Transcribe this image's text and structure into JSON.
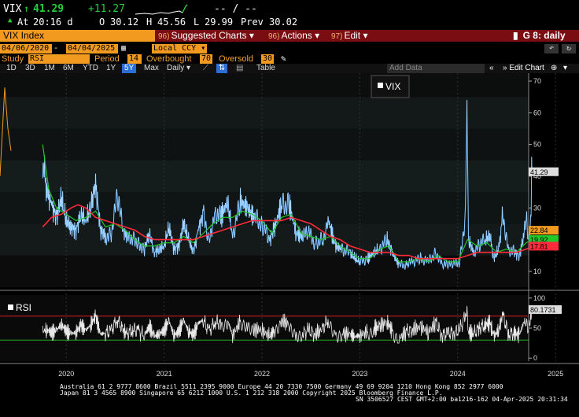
{
  "quote": {
    "ticker": "VIX",
    "last": "41.29",
    "change": "+11.27",
    "bid_ask": "-- / --"
  },
  "info": {
    "time_label": "At",
    "time": "20:16 d",
    "open_label": "O",
    "open": "30.12",
    "high_label": "H",
    "high": "45.56",
    "low_label": "L",
    "low": "29.99",
    "prev_label": "Prev",
    "prev": "30.02"
  },
  "menubar": {
    "security": "VIX Index",
    "items": [
      {
        "num": "96)",
        "label": "Suggested Charts ▾"
      },
      {
        "num": "96)",
        "label": "Actions ▾"
      },
      {
        "num": "97)",
        "label": "Edit ▾"
      }
    ],
    "page": "G 8: daily"
  },
  "daterow": {
    "start": "04/06/2020",
    "end": "04/04/2025",
    "currency": "Local CCY"
  },
  "studyrow": {
    "study_label": "Study",
    "study": "RSI",
    "period_label": "Period",
    "period": "14",
    "overbought_label": "Overbought",
    "overbought": "70",
    "oversold_label": "Oversold",
    "oversold": "30"
  },
  "toolbar": {
    "ranges": [
      "1D",
      "3D",
      "1M",
      "6M",
      "YTD",
      "1Y",
      "5Y",
      "Max"
    ],
    "active_range": "5Y",
    "frequency": "Daily ▾",
    "table": "Table",
    "add_data_placeholder": "Add Data",
    "edit_chart": "Edit Chart"
  },
  "chart_data": [
    {
      "type": "line",
      "legend": [
        {
          "name": "VIX",
          "color": "#ffffff"
        }
      ],
      "x_ticks": [
        "2020",
        "2021",
        "2022",
        "2023",
        "2024",
        "2025"
      ],
      "y_ticks": [
        10,
        20,
        30,
        40,
        50,
        60,
        70
      ],
      "ylim": [
        5,
        72
      ],
      "series_colors": {
        "price": "#4aa8ff",
        "ma_fast": "#22c82a",
        "ma_slow": "#ff2a3a"
      },
      "last_value_tags": [
        {
          "value": "41.29",
          "y": 41.29,
          "bg": "#dddddd",
          "fg": "#000000"
        },
        {
          "value": "22.84",
          "y": 22.84,
          "bg": "#f29a1f",
          "fg": "#000000"
        },
        {
          "value": "19.92",
          "y": 19.92,
          "bg": "#22c82a",
          "fg": "#000000"
        },
        {
          "value": "17.81",
          "y": 17.81,
          "bg": "#ff2a3a",
          "fg": "#000000"
        }
      ],
      "price_points": [
        [
          2020.26,
          45
        ],
        [
          2020.3,
          36
        ],
        [
          2020.35,
          31
        ],
        [
          2020.4,
          27
        ],
        [
          2020.45,
          33
        ],
        [
          2020.5,
          26
        ],
        [
          2020.55,
          24
        ],
        [
          2020.6,
          23
        ],
        [
          2020.65,
          28
        ],
        [
          2020.7,
          26
        ],
        [
          2020.75,
          30
        ],
        [
          2020.8,
          38
        ],
        [
          2020.85,
          23
        ],
        [
          2020.9,
          21
        ],
        [
          2020.96,
          22
        ],
        [
          2021.02,
          33
        ],
        [
          2021.08,
          24
        ],
        [
          2021.12,
          20
        ],
        [
          2021.18,
          21
        ],
        [
          2021.24,
          19
        ],
        [
          2021.3,
          17
        ],
        [
          2021.35,
          22
        ],
        [
          2021.4,
          16
        ],
        [
          2021.45,
          17
        ],
        [
          2021.5,
          18
        ],
        [
          2021.55,
          24
        ],
        [
          2021.6,
          17
        ],
        [
          2021.65,
          18
        ],
        [
          2021.7,
          25
        ],
        [
          2021.75,
          20
        ],
        [
          2021.8,
          16
        ],
        [
          2021.85,
          23
        ],
        [
          2021.9,
          28
        ],
        [
          2021.96,
          20
        ],
        [
          2022.02,
          29
        ],
        [
          2022.08,
          27
        ],
        [
          2022.15,
          32
        ],
        [
          2022.2,
          21
        ],
        [
          2022.28,
          32
        ],
        [
          2022.35,
          30
        ],
        [
          2022.42,
          27
        ],
        [
          2022.5,
          25
        ],
        [
          2022.58,
          20
        ],
        [
          2022.63,
          24
        ],
        [
          2022.7,
          31
        ],
        [
          2022.78,
          31
        ],
        [
          2022.85,
          22
        ],
        [
          2022.92,
          21
        ],
        [
          2022.98,
          22
        ],
        [
          2023.04,
          19
        ],
        [
          2023.12,
          20
        ],
        [
          2023.18,
          26
        ],
        [
          2023.25,
          18
        ],
        [
          2023.32,
          17
        ],
        [
          2023.4,
          16
        ],
        [
          2023.45,
          14
        ],
        [
          2023.5,
          13
        ],
        [
          2023.58,
          14
        ],
        [
          2023.65,
          16
        ],
        [
          2023.7,
          17
        ],
        [
          2023.78,
          20
        ],
        [
          2023.83,
          16
        ],
        [
          2023.9,
          12
        ],
        [
          2023.98,
          12
        ],
        [
          2024.04,
          13
        ],
        [
          2024.12,
          14
        ],
        [
          2024.2,
          13
        ],
        [
          2024.28,
          16
        ],
        [
          2024.34,
          12
        ],
        [
          2024.4,
          12
        ],
        [
          2024.46,
          12
        ],
        [
          2024.52,
          13
        ],
        [
          2024.58,
          28
        ],
        [
          2024.595,
          65
        ],
        [
          2024.61,
          20
        ],
        [
          2024.66,
          16
        ],
        [
          2024.72,
          18
        ],
        [
          2024.78,
          20
        ],
        [
          2024.83,
          21
        ],
        [
          2024.87,
          14
        ],
        [
          2024.92,
          17
        ],
        [
          2024.96,
          28
        ],
        [
          2025.02,
          17
        ],
        [
          2025.08,
          16
        ],
        [
          2025.13,
          15
        ],
        [
          2025.18,
          22
        ],
        [
          2025.2,
          27
        ],
        [
          2025.22,
          21
        ],
        [
          2025.24,
          22
        ],
        [
          2025.25,
          30
        ],
        [
          2025.256,
          45.56
        ],
        [
          2025.26,
          41.29
        ]
      ],
      "ma_fast_points": [
        [
          2020.26,
          50
        ],
        [
          2020.32,
          36
        ],
        [
          2020.4,
          30
        ],
        [
          2020.5,
          28
        ],
        [
          2020.6,
          26
        ],
        [
          2020.7,
          27
        ],
        [
          2020.8,
          29
        ],
        [
          2020.9,
          24
        ],
        [
          2021.0,
          25
        ],
        [
          2021.1,
          23
        ],
        [
          2021.2,
          20
        ],
        [
          2021.3,
          18
        ],
        [
          2021.4,
          18
        ],
        [
          2021.5,
          19
        ],
        [
          2021.6,
          19
        ],
        [
          2021.7,
          21
        ],
        [
          2021.8,
          19
        ],
        [
          2021.9,
          22
        ],
        [
          2022.0,
          25
        ],
        [
          2022.1,
          27
        ],
        [
          2022.2,
          27
        ],
        [
          2022.3,
          29
        ],
        [
          2022.4,
          28
        ],
        [
          2022.5,
          26
        ],
        [
          2022.6,
          22
        ],
        [
          2022.7,
          27
        ],
        [
          2022.8,
          28
        ],
        [
          2022.9,
          22
        ],
        [
          2023.0,
          21
        ],
        [
          2023.1,
          20
        ],
        [
          2023.2,
          21
        ],
        [
          2023.3,
          18
        ],
        [
          2023.4,
          16
        ],
        [
          2023.5,
          14
        ],
        [
          2023.6,
          14
        ],
        [
          2023.7,
          17
        ],
        [
          2023.8,
          18
        ],
        [
          2023.9,
          13
        ],
        [
          2024.0,
          13
        ],
        [
          2024.1,
          14
        ],
        [
          2024.2,
          13
        ],
        [
          2024.3,
          15
        ],
        [
          2024.4,
          13
        ],
        [
          2024.5,
          13
        ],
        [
          2024.6,
          20
        ],
        [
          2024.7,
          18
        ],
        [
          2024.8,
          19
        ],
        [
          2024.9,
          16
        ],
        [
          2025.0,
          17
        ],
        [
          2025.1,
          16
        ],
        [
          2025.2,
          19
        ],
        [
          2025.26,
          19.92
        ]
      ],
      "ma_slow_points": [
        [
          2020.26,
          24
        ],
        [
          2020.35,
          27
        ],
        [
          2020.45,
          28
        ],
        [
          2020.55,
          30
        ],
        [
          2020.62,
          31
        ],
        [
          2020.7,
          30
        ],
        [
          2020.8,
          27
        ],
        [
          2020.9,
          26
        ],
        [
          2021.0,
          25
        ],
        [
          2021.1,
          24
        ],
        [
          2021.2,
          23
        ],
        [
          2021.3,
          21
        ],
        [
          2021.4,
          20
        ],
        [
          2021.5,
          20
        ],
        [
          2021.6,
          20
        ],
        [
          2021.7,
          20
        ],
        [
          2021.8,
          20
        ],
        [
          2021.9,
          21
        ],
        [
          2022.0,
          22
        ],
        [
          2022.1,
          23
        ],
        [
          2022.2,
          24
        ],
        [
          2022.3,
          25
        ],
        [
          2022.4,
          26
        ],
        [
          2022.5,
          26
        ],
        [
          2022.6,
          26
        ],
        [
          2022.7,
          26
        ],
        [
          2022.8,
          27
        ],
        [
          2022.9,
          26
        ],
        [
          2023.0,
          25
        ],
        [
          2023.1,
          23
        ],
        [
          2023.2,
          21
        ],
        [
          2023.3,
          20
        ],
        [
          2023.4,
          18
        ],
        [
          2023.5,
          17
        ],
        [
          2023.6,
          16
        ],
        [
          2023.7,
          16
        ],
        [
          2023.8,
          16
        ],
        [
          2023.9,
          15
        ],
        [
          2024.0,
          15
        ],
        [
          2024.1,
          14
        ],
        [
          2024.2,
          14
        ],
        [
          2024.3,
          14
        ],
        [
          2024.4,
          14
        ],
        [
          2024.5,
          14
        ],
        [
          2024.6,
          15
        ],
        [
          2024.7,
          16
        ],
        [
          2024.8,
          16
        ],
        [
          2024.9,
          16
        ],
        [
          2025.0,
          16
        ],
        [
          2025.1,
          16
        ],
        [
          2025.2,
          17
        ],
        [
          2025.26,
          17.81
        ]
      ]
    },
    {
      "type": "line",
      "legend": [
        {
          "name": "RSI",
          "color": "#ffffff"
        }
      ],
      "y_ticks": [
        0,
        50,
        100
      ],
      "ylim": [
        -5,
        105
      ],
      "overbought": 70,
      "oversold": 30,
      "last_value_tag": {
        "value": "80.1731",
        "y": 80.17
      },
      "rsi_points": [
        [
          2020.26,
          44
        ],
        [
          2020.3,
          48
        ],
        [
          2020.35,
          42
        ],
        [
          2020.4,
          46
        ],
        [
          2020.45,
          57
        ],
        [
          2020.5,
          44
        ],
        [
          2020.55,
          41
        ],
        [
          2020.6,
          43
        ],
        [
          2020.65,
          55
        ],
        [
          2020.7,
          46
        ],
        [
          2020.75,
          56
        ],
        [
          2020.8,
          70
        ],
        [
          2020.85,
          40
        ],
        [
          2020.9,
          42
        ],
        [
          2020.96,
          45
        ],
        [
          2021.02,
          66
        ],
        [
          2021.08,
          46
        ],
        [
          2021.12,
          40
        ],
        [
          2021.18,
          48
        ],
        [
          2021.24,
          44
        ],
        [
          2021.3,
          39
        ],
        [
          2021.35,
          53
        ],
        [
          2021.4,
          36
        ],
        [
          2021.45,
          41
        ],
        [
          2021.5,
          46
        ],
        [
          2021.55,
          62
        ],
        [
          2021.6,
          38
        ],
        [
          2021.65,
          44
        ],
        [
          2021.7,
          63
        ],
        [
          2021.75,
          45
        ],
        [
          2021.8,
          38
        ],
        [
          2021.85,
          58
        ],
        [
          2021.9,
          64
        ],
        [
          2021.96,
          43
        ],
        [
          2022.02,
          62
        ],
        [
          2022.08,
          55
        ],
        [
          2022.15,
          63
        ],
        [
          2022.2,
          38
        ],
        [
          2022.28,
          61
        ],
        [
          2022.35,
          57
        ],
        [
          2022.42,
          48
        ],
        [
          2022.5,
          47
        ],
        [
          2022.58,
          36
        ],
        [
          2022.63,
          48
        ],
        [
          2022.7,
          62
        ],
        [
          2022.78,
          57
        ],
        [
          2022.85,
          40
        ],
        [
          2022.92,
          42
        ],
        [
          2022.98,
          46
        ],
        [
          2023.04,
          40
        ],
        [
          2023.12,
          48
        ],
        [
          2023.18,
          66
        ],
        [
          2023.25,
          39
        ],
        [
          2023.32,
          42
        ],
        [
          2023.4,
          40
        ],
        [
          2023.45,
          36
        ],
        [
          2023.5,
          38
        ],
        [
          2023.58,
          43
        ],
        [
          2023.65,
          50
        ],
        [
          2023.7,
          52
        ],
        [
          2023.78,
          61
        ],
        [
          2023.83,
          44
        ],
        [
          2023.9,
          33
        ],
        [
          2023.98,
          43
        ],
        [
          2024.04,
          48
        ],
        [
          2024.12,
          52
        ],
        [
          2024.2,
          44
        ],
        [
          2024.28,
          58
        ],
        [
          2024.34,
          38
        ],
        [
          2024.4,
          41
        ],
        [
          2024.46,
          43
        ],
        [
          2024.52,
          46
        ],
        [
          2024.58,
          72
        ],
        [
          2024.595,
          85
        ],
        [
          2024.61,
          44
        ],
        [
          2024.66,
          40
        ],
        [
          2024.72,
          50
        ],
        [
          2024.78,
          56
        ],
        [
          2024.83,
          58
        ],
        [
          2024.87,
          36
        ],
        [
          2024.92,
          48
        ],
        [
          2024.96,
          72
        ],
        [
          2025.02,
          40
        ],
        [
          2025.08,
          42
        ],
        [
          2025.13,
          38
        ],
        [
          2025.18,
          62
        ],
        [
          2025.2,
          68
        ],
        [
          2025.22,
          50
        ],
        [
          2025.24,
          54
        ],
        [
          2025.25,
          70
        ],
        [
          2025.26,
          80.17
        ]
      ]
    }
  ],
  "footer": {
    "line1": "Australia 61 2 9777 8600 Brazil 5511 2395 9000 Europe 44 20 7330 7500 Germany 49 69 9204 1210 Hong Kong 852 2977 6000",
    "line2": "Japan 81 3 4565 8900        Singapore 65 6212 1000        U.S. 1 212 318 2000                 Copyright 2025 Bloomberg Finance L.P.",
    "line3": "SN 3506527 CEST GMT+2:00 ba1216-162 04-Apr-2025 20:31:34"
  }
}
